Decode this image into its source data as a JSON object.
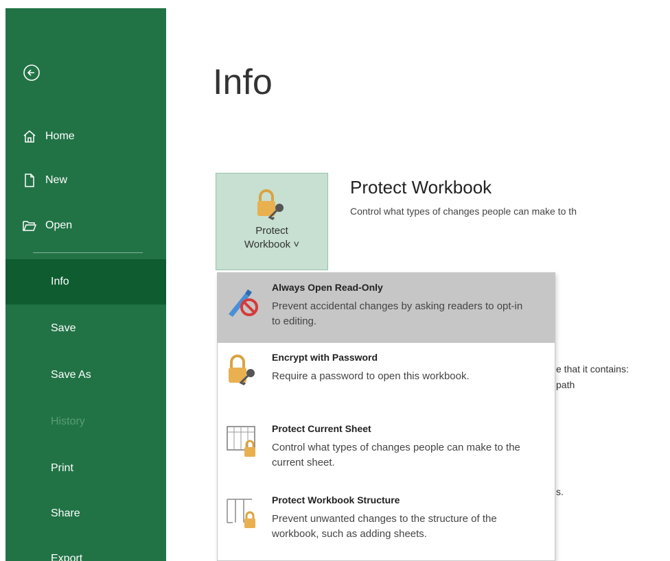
{
  "sidebar": {
    "back_label": "",
    "top_items": [
      {
        "label": "Home",
        "icon": "home-icon"
      },
      {
        "label": "New",
        "icon": "new-document-icon"
      },
      {
        "label": "Open",
        "icon": "open-folder-icon"
      }
    ],
    "items": [
      {
        "label": "Info",
        "active": true
      },
      {
        "label": "Save"
      },
      {
        "label": "Save As"
      },
      {
        "label": "History",
        "disabled": true
      },
      {
        "label": "Print"
      },
      {
        "label": "Share"
      },
      {
        "label": "Export"
      }
    ]
  },
  "main": {
    "title": "Info",
    "protect_button": {
      "line1": "Protect",
      "line2": "Workbook ˅"
    },
    "protect_section": {
      "title": "Protect Workbook",
      "description": "Control what types of changes people can make to th"
    },
    "background_text": {
      "line1": "e that it contains:",
      "line2": "path",
      "line3": "s."
    }
  },
  "menu": {
    "items": [
      {
        "title": "Always Open Read-Only",
        "description": "Prevent accidental changes by asking readers to opt-in to editing.",
        "icon": "no-edit-pencil-icon"
      },
      {
        "title": "Encrypt with Password",
        "description": "Require a password to open this workbook.",
        "icon": "lock-key-icon"
      },
      {
        "title": "Protect Current Sheet",
        "description": "Control what types of changes people can make to the current sheet.",
        "icon": "sheet-lock-icon"
      },
      {
        "title": "Protect Workbook Structure",
        "description": "Prevent unwanted changes to the structure of the workbook, such as adding sheets.",
        "icon": "workbook-structure-lock-icon"
      }
    ]
  },
  "colors": {
    "sidebar": "#217346",
    "active": "#0e5c30",
    "button_bg": "#c7e0d1",
    "hover": "#c6c6c6"
  }
}
